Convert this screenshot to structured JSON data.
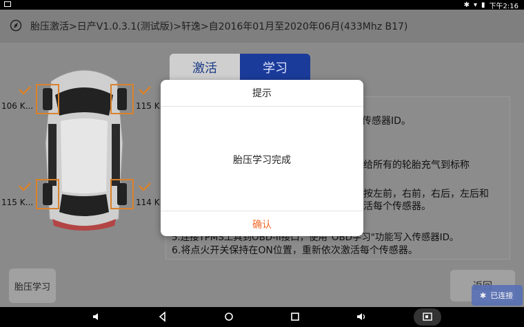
{
  "statusbar": {
    "time": "下午2:16"
  },
  "header": {
    "title": "胎压激活>日产V1.0.3.1(测试版)>轩逸>自2016年01月至2020年06月(433Mhz B17)"
  },
  "tabs": {
    "activate": "激活",
    "learn": "学习"
  },
  "tires": {
    "front_left": "106 K...",
    "front_right": "115 K...",
    "rear_left": "115 K...",
    "rear_right": "114 K..."
  },
  "instructions": {
    "fragments": [
      "传感器ID。",
      "给所有的轮胎充气到标称",
      "按左前，右前，右后，左后和",
      "活每个传感器。",
      "5.连接TPMS工具到OBD-II接口，使用\"OBD学习\"功能写入传感器ID。",
      "6.将点火开关保持在ON位置，重新依次激活每个传感器。"
    ]
  },
  "buttons": {
    "tire_learn": "胎压学习",
    "return": "返回"
  },
  "connection": {
    "status": "已连接"
  },
  "dialog": {
    "title": "提示",
    "message": "胎压学习完成",
    "confirm": "确认"
  },
  "colors": {
    "accent_blue": "#1b3b9a",
    "confirm_orange": "#f2692a",
    "check_orange": "#d9822b"
  }
}
